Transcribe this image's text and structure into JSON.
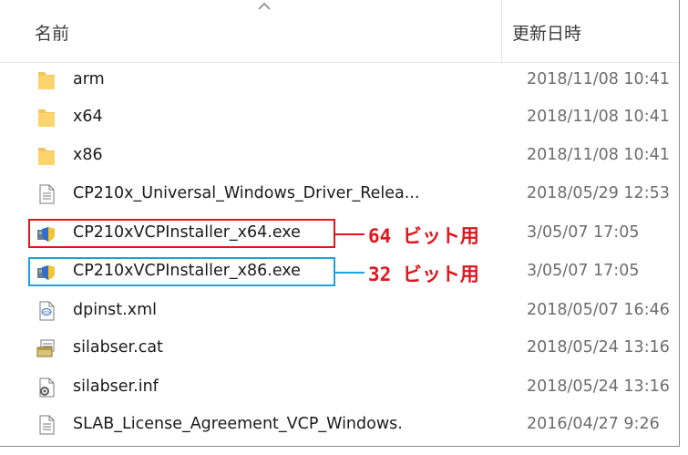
{
  "header": {
    "name_label": "名前",
    "date_label": "更新日時"
  },
  "files": [
    {
      "name": "arm",
      "date": "2018/11/08 10:41",
      "icon": "folder-icon"
    },
    {
      "name": "x64",
      "date": "2018/11/08 10:41",
      "icon": "folder-icon"
    },
    {
      "name": "x86",
      "date": "2018/11/08 10:41",
      "icon": "folder-icon"
    },
    {
      "name": "CP210x_Universal_Windows_Driver_Relea...",
      "date": "2018/05/29 12:53",
      "icon": "text-file-icon"
    },
    {
      "name": "CP210xVCPInstaller_x64.exe",
      "date": "3/05/07 17:05",
      "icon": "installer-exe-icon"
    },
    {
      "name": "CP210xVCPInstaller_x86.exe",
      "date": "3/05/07 17:05",
      "icon": "installer-exe-icon"
    },
    {
      "name": "dpinst.xml",
      "date": "2018/05/07 16:46",
      "icon": "xml-file-icon"
    },
    {
      "name": "silabser.cat",
      "date": "2018/05/24 13:16",
      "icon": "security-catalog-icon"
    },
    {
      "name": "silabser.inf",
      "date": "2018/05/24 13:16",
      "icon": "setup-info-icon"
    },
    {
      "name": "SLAB_License_Agreement_VCP_Windows.",
      "date": "2016/04/27 9:26",
      "icon": "text-file-icon"
    }
  ],
  "annotations": {
    "x64_label": "64 ビット用",
    "x86_label": "32 ビット用",
    "red_color": "#e0161e",
    "blue_color": "#1aa3e0"
  }
}
